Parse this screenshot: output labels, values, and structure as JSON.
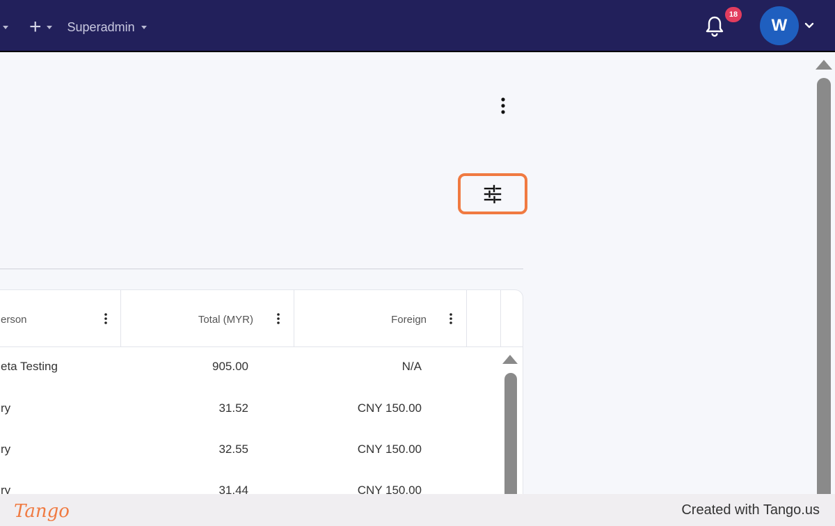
{
  "topbar": {
    "role_label": "Superadmin",
    "notification_count": "18",
    "avatar_initial": "W"
  },
  "table": {
    "headers": [
      "erson",
      "Total (MYR)",
      "Foreign"
    ],
    "rows": [
      {
        "person": "eta Testing",
        "total": "905.00",
        "foreign": "N/A"
      },
      {
        "person": "ry",
        "total": "31.52",
        "foreign": "CNY 150.00"
      },
      {
        "person": "ry",
        "total": "32.55",
        "foreign": "CNY 150.00"
      },
      {
        "person": "ry",
        "total": "31.44",
        "foreign": "CNY 150.00"
      }
    ]
  },
  "footer": {
    "brand": "Tango",
    "credit": "Created with Tango.us"
  },
  "colors": {
    "topbar": "#22205b",
    "highlight": "#f07a41",
    "badge": "#e23d5e",
    "avatar": "#1f5fbf"
  }
}
